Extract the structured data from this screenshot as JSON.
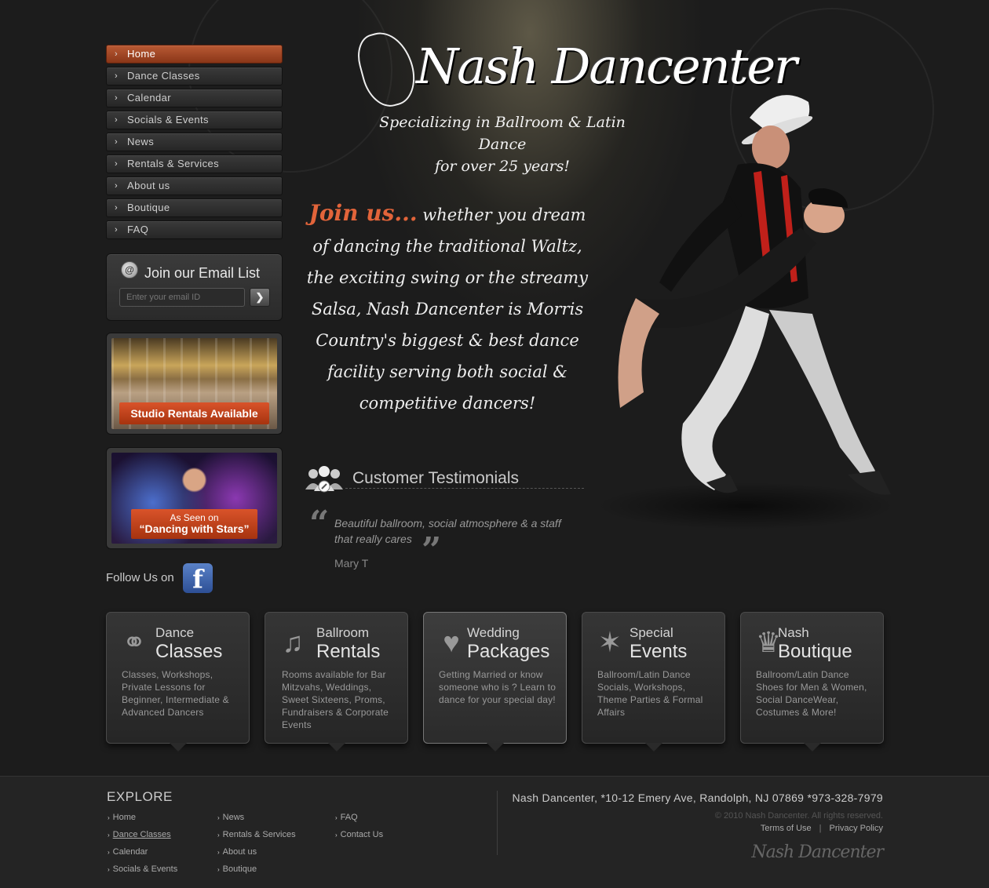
{
  "nav": {
    "items": [
      {
        "label": "Home",
        "active": true
      },
      {
        "label": "Dance Classes"
      },
      {
        "label": "Calendar"
      },
      {
        "label": "Socials & Events"
      },
      {
        "label": "News"
      },
      {
        "label": "Rentals & Services"
      },
      {
        "label": "About us"
      },
      {
        "label": "Boutique"
      },
      {
        "label": "FAQ"
      }
    ]
  },
  "email": {
    "title": "Join our Email List",
    "placeholder": "Enter your email ID",
    "go_label": "❯"
  },
  "promos": {
    "rentals": "Studio Rentals Available",
    "dws_line1": "As Seen on",
    "dws_line2": "“Dancing with Stars”"
  },
  "follow": {
    "label": "Follow Us on",
    "icon": "facebook-icon"
  },
  "brand": {
    "name": "Nash Dancenter",
    "tagline_line1": "Specializing in Ballroom & Latin Dance",
    "tagline_line2": "for over 25 years!"
  },
  "intro": {
    "join": "Join us...",
    "body": " whether you dream of dancing the traditional Waltz, the exciting swing or the streamy Salsa, Nash Dancenter is Morris Country's biggest & best dance facility serving both social & competitive dancers!"
  },
  "testimonials": {
    "title": "Customer Testimonials",
    "quote": "Beautiful ballroom, social atmosphere & a staff that really cares",
    "author": "Mary T"
  },
  "features": [
    {
      "t1": "Dance",
      "t2": "Classes",
      "desc": "Classes, Workshops, Private Lessons for Beginner, Intermediate & Advanced Dancers",
      "icon": "couple-standing-icon"
    },
    {
      "t1": "Ballroom",
      "t2": "Rentals",
      "desc": "Rooms available for Bar Mitzvahs, Weddings, Sweet Sixteens, Proms, Fundraisers & Corporate Events",
      "icon": "couple-dancing-icon"
    },
    {
      "t1": "Wedding",
      "t2": "Packages",
      "desc": "Getting Married or know someone who is ? Learn to dance for your special day!",
      "icon": "bride-groom-icon"
    },
    {
      "t1": "Special",
      "t2": "Events",
      "desc": "Ballroom/Latin Dance Socials, Workshops, Theme Parties & Formal Affairs",
      "icon": "party-dancers-icon"
    },
    {
      "t1": "Nash",
      "t2": "Boutique",
      "desc": "Ballroom/Latin Dance Shoes for Men & Women, Social DanceWear, Costumes & More!",
      "icon": "dress-icon"
    }
  ],
  "footer": {
    "explore": "EXPLORE",
    "links_col1": [
      "Home",
      "Dance Classes",
      "Calendar",
      "Socials & Events"
    ],
    "links_col2": [
      "News",
      "Rentals & Services",
      "About us",
      "Boutique"
    ],
    "links_col3": [
      "FAQ",
      "Contact Us"
    ],
    "address": "Nash Dancenter, *10-12 Emery Ave, Randolph, NJ 07869 *973-328-7979",
    "copyright": "© 2010 Nash Dancenter. All rights reserved.",
    "terms": "Terms of Use",
    "privacy": "Privacy Policy",
    "logo": "Nash Dancenter"
  },
  "colors": {
    "accent": "#b95a34",
    "banner": "#c9431c",
    "background": "#1c1c1c"
  }
}
